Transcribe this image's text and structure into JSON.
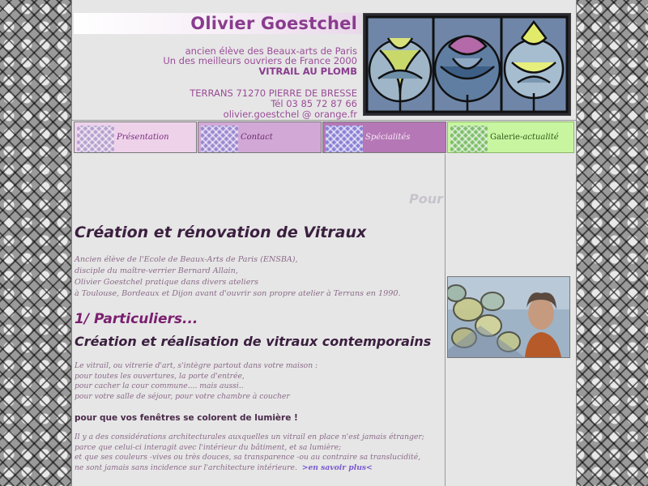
{
  "header": {
    "title": "Olivier Goestchel",
    "line1": "ancien élève des Beaux-arts de Paris",
    "line2": "Un des meilleurs ouvriers de France 2000",
    "line3": "VITRAIL AU PLOMB",
    "address": "TERRANS 71270 PIERRE DE BRESSE",
    "phone": "Tél 03 85 72 87 66",
    "email": "olivier.goestchel @ orange.fr"
  },
  "nav": [
    {
      "label": "Présentation"
    },
    {
      "label": "Contact"
    },
    {
      "label": "Spécialités"
    },
    {
      "label": "Galerie-",
      "suffix": "actualité"
    }
  ],
  "main": {
    "pour": "Pour",
    "heading": "Création et rénovation de Vitraux",
    "intro": [
      "Ancien élève de l'Ecole de Beaux-Arts de Paris (ENSBA),",
      "disciple du maître-verrier Bernard Allain,",
      "Olivier Goestchel pratique dans divers ateliers",
      "à Toulouse, Bordeaux et Dijon avant d'ouvrir son propre atelier à Terrans en 1990."
    ],
    "section1": "1/ Particuliers...",
    "section1_sub": "Création et réalisation de vitraux contemporains",
    "para1": [
      "Le vitrail, ou vitrerie d'art, s'intègre partout dans votre maison :",
      "pour toutes les ouvertures, la porte d'entrée,",
      "pour cacher la cour commune.... mais aussi..",
      "pour votre salle de séjour,  pour votre chambre à coucher"
    ],
    "bold_line": "pour que vos fenêtres se colorent de lumière !",
    "para3": [
      "Il y a des considérations architecturales auxquelles un vitrail en place n'est jamais étranger;",
      "parce que celui-ci interagit avec l'intérieur du bâtiment, et sa lumière;",
      "et que ses couleurs -vives ou très douces, sa transparence -ou au contraire sa translucidité,",
      "ne sont jamais sans incidence sur l'architecture intérieure."
    ],
    "more_link": ">en savoir plus<"
  },
  "icons": {
    "window_art": "stained-glass-icon",
    "photo": "artist-photo-icon"
  },
  "colors": {
    "title": "#8a3c8e",
    "nav_presentation": "#eed2ea",
    "nav_contact": "#d2a8d6",
    "nav_specialites": "#b577b6",
    "nav_galerie": "#c8f5a0"
  }
}
